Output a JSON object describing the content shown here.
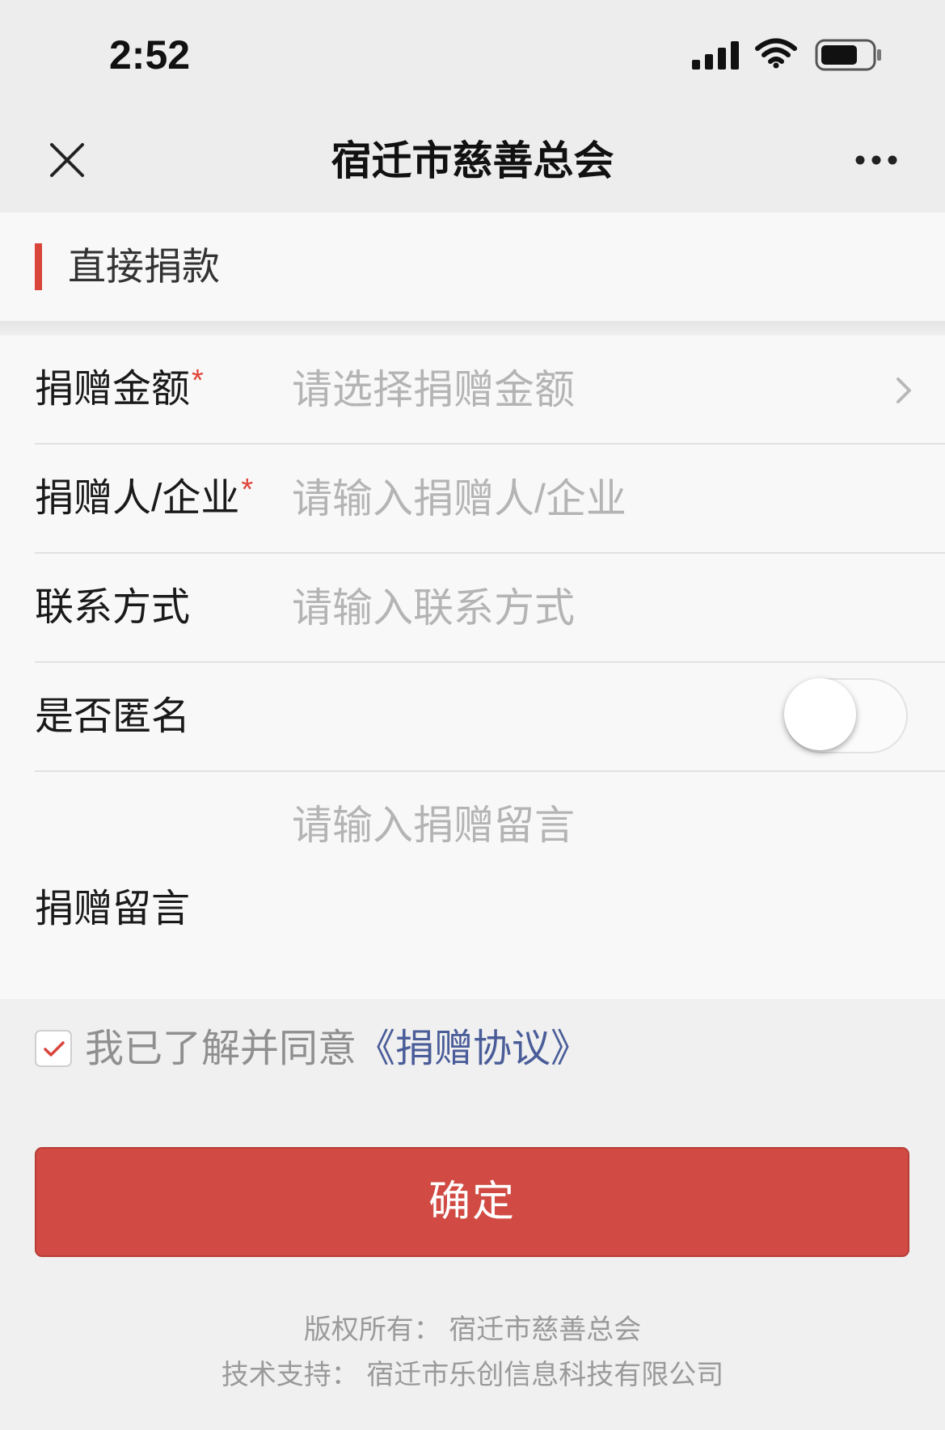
{
  "status_bar": {
    "time": "2:52",
    "signal_icon": "signal-icon",
    "wifi_icon": "wifi-icon",
    "battery_icon": "battery-icon"
  },
  "nav": {
    "title": "宿迁市慈善总会",
    "close_icon": "close-icon",
    "more_icon": "more-icon"
  },
  "section": {
    "title": "直接捐款"
  },
  "form": {
    "amount": {
      "label": "捐赠金额",
      "required_mark": "*",
      "placeholder": "请选择捐赠金额",
      "icon": "chevron-right-icon"
    },
    "donor": {
      "label": "捐赠人/企业",
      "required_mark": "*",
      "placeholder": "请输入捐赠人/企业"
    },
    "contact": {
      "label": "联系方式",
      "placeholder": "请输入联系方式"
    },
    "anonymous": {
      "label": "是否匿名",
      "checked": false
    },
    "message": {
      "label": "捐赠留言",
      "placeholder": "请输入捐赠留言"
    }
  },
  "agreement": {
    "checked": true,
    "text": "我已了解并同意",
    "link": "《捐赠协议》"
  },
  "submit": {
    "label": "确定"
  },
  "footer": {
    "copyright": "版权所有： 宿迁市慈善总会",
    "support": "技术支持： 宿迁市乐创信息科技有限公司"
  },
  "colors": {
    "accent_red": "#d14b44",
    "required_red": "#e0443a",
    "link_blue": "#4a5d99",
    "placeholder_gray": "#b4b4b4"
  }
}
